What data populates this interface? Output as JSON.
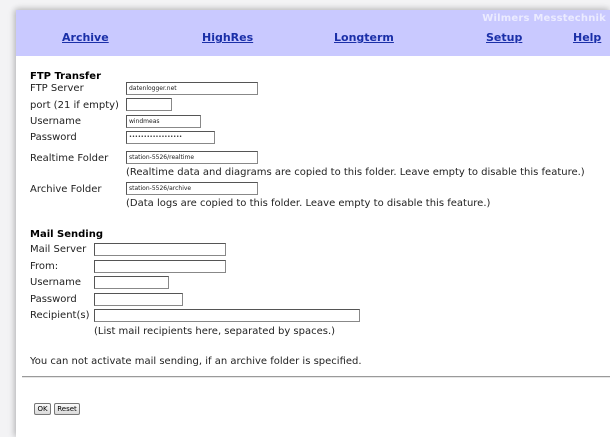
{
  "brand": "Wilmers Messtechnik",
  "nav": {
    "archive": "Archive",
    "highres": "HighRes",
    "longterm": "Longterm",
    "setup": "Setup",
    "help": "Help"
  },
  "ftp": {
    "title": "FTP Transfer",
    "server_label": "FTP Server",
    "server_value": "datenlogger.net",
    "port_label": "port (21 if empty)",
    "port_value": "",
    "username_label": "Username",
    "username_value": "windmeas",
    "password_label": "Password",
    "password_value": "••••••••••••••••••",
    "realtime_label": "Realtime Folder",
    "realtime_value": "station-5526/realtime",
    "realtime_note": "(Realtime data and diagrams are copied to this folder. Leave empty to disable this feature.)",
    "archive_label": "Archive Folder",
    "archive_value": "station-5526/archive",
    "archive_note": "(Data logs are copied to this folder. Leave empty to disable this feature.)"
  },
  "mail": {
    "title": "Mail Sending",
    "server_label": "Mail Server",
    "server_value": "",
    "from_label": "From:",
    "from_value": "",
    "username_label": "Username",
    "username_value": "",
    "password_label": "Password",
    "password_value": "",
    "recipients_label": "Recipient(s)",
    "recipients_value": "",
    "recipients_note": "(List mail recipients here, separated by spaces.)",
    "warning": "You can not activate mail sending, if an archive folder is specified."
  },
  "buttons": {
    "ok": "OK",
    "reset": "Reset"
  },
  "colors": {
    "navbar": "#c9c9ff",
    "link": "#1a2fa8",
    "brand": "#ebebff"
  }
}
